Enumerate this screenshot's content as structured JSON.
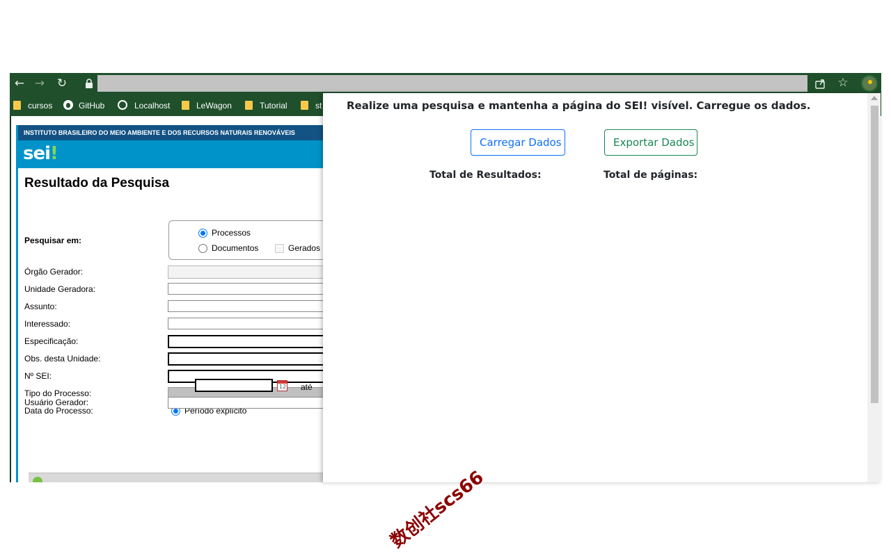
{
  "browser": {
    "back_icon": "arrow-left-icon",
    "forward_icon": "arrow-right-icon",
    "reload_icon": "reload-icon",
    "lock_icon": "lock-icon",
    "address": "",
    "bookmarks": [
      {
        "label": "cursos",
        "icon": "folder-icon"
      },
      {
        "label": "GitHub",
        "icon": "github-icon"
      },
      {
        "label": "Localhost",
        "icon": "globe-icon"
      },
      {
        "label": "LeWagon",
        "icon": "folder-icon"
      },
      {
        "label": "Tutorial",
        "icon": "folder-icon"
      },
      {
        "label": "st",
        "icon": "folder-icon"
      }
    ]
  },
  "sei": {
    "institute": "INSTITUTO BRASILEIRO DO MEIO AMBIENTE E DOS RECURSOS NATURAIS RENOVÁVEIS",
    "logo": "sei",
    "logo_bang": "!",
    "page_title": "Resultado da Pesquisa",
    "search_in_label": "Pesquisar em:",
    "option_processos": "Processos",
    "option_documentos": "Documentos",
    "option_gerados": "Gerados",
    "fields": {
      "orgao": "Órgão Gerador:",
      "unidade": "Unidade Geradora:",
      "assunto": "Assunto:",
      "interessado": "Interessado:",
      "especificacao": "Especificação:",
      "obs": "Obs. desta Unidade:",
      "nsei": "Nº SEI:",
      "tipo": "Tipo do Processo:",
      "data": "Data do Processo:",
      "usuario": "Usuário Gerador:"
    },
    "periodo_explicito": "Período explícito",
    "ate": "até"
  },
  "panel": {
    "message": "Realize uma pesquisa e mantenha a página do SEI! visível. Carregue os dados.",
    "load_button": "Carregar Dados",
    "export_button": "Exportar Dados",
    "total_results": "Total de Resultados:",
    "total_pages": "Total de páginas:"
  },
  "watermark": "数创社scs66",
  "colors": {
    "browser_chrome": "#1f4f2b",
    "sei_blue": "#0093c9",
    "sei_dark_blue": "#135384",
    "load_button": "#0d6efd",
    "export_button": "#198754"
  }
}
